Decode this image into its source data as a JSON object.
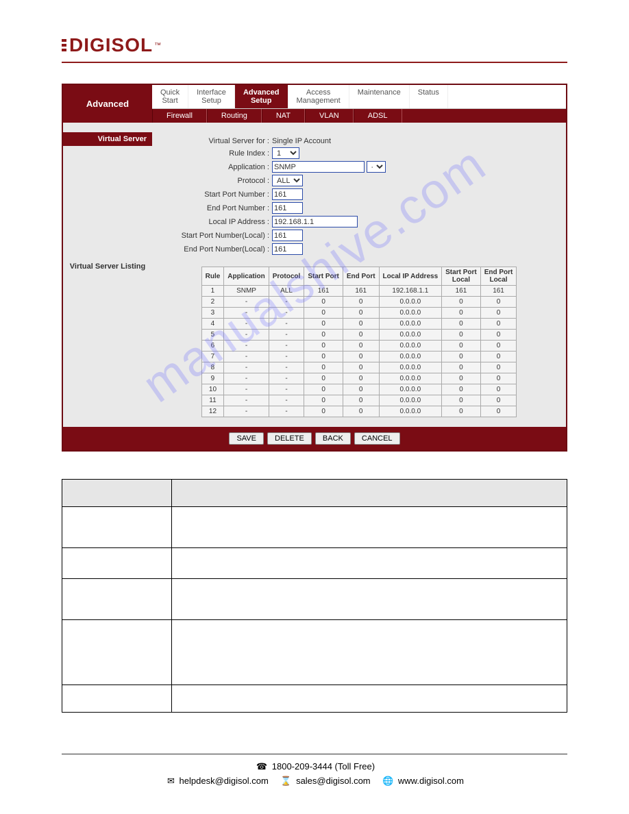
{
  "logo": {
    "text": "DIGISOL",
    "tm": "™"
  },
  "header": {
    "left_label": "Advanced",
    "tabs": [
      {
        "label": "Quick\nStart"
      },
      {
        "label": "Interface\nSetup"
      },
      {
        "label": "Advanced\nSetup",
        "active": true
      },
      {
        "label": "Access\nManagement"
      },
      {
        "label": "Maintenance"
      },
      {
        "label": "Status"
      }
    ],
    "subtabs": [
      "Firewall",
      "Routing",
      "NAT",
      "VLAN",
      "ADSL"
    ]
  },
  "sections": {
    "virtual_server": "Virtual Server",
    "virtual_server_listing": "Virtual Server Listing"
  },
  "form": {
    "virtual_server_for_label": "Virtual Server for :",
    "virtual_server_for_value": "Single IP Account",
    "rule_index_label": "Rule Index :",
    "rule_index_value": "1",
    "application_label": "Application :",
    "application_value": "SNMP",
    "application_select2": "-",
    "protocol_label": "Protocol :",
    "protocol_value": "ALL",
    "start_port_label": "Start Port Number :",
    "start_port_value": "161",
    "end_port_label": "End Port Number :",
    "end_port_value": "161",
    "local_ip_label": "Local IP Address :",
    "local_ip_value": "192.168.1.1",
    "start_port_local_label": "Start Port Number(Local) :",
    "start_port_local_value": "161",
    "end_port_local_label": "End Port Number(Local) :",
    "end_port_local_value": "161"
  },
  "listing_headers": [
    "Rule",
    "Application",
    "Protocol",
    "Start Port",
    "End Port",
    "Local IP Address",
    "Start Port Local",
    "End Port Local"
  ],
  "listing_rows": [
    [
      "1",
      "SNMP",
      "ALL",
      "161",
      "161",
      "192.168.1.1",
      "161",
      "161"
    ],
    [
      "2",
      "-",
      "-",
      "0",
      "0",
      "0.0.0.0",
      "0",
      "0"
    ],
    [
      "3",
      "-",
      "-",
      "0",
      "0",
      "0.0.0.0",
      "0",
      "0"
    ],
    [
      "4",
      "-",
      "-",
      "0",
      "0",
      "0.0.0.0",
      "0",
      "0"
    ],
    [
      "5",
      "-",
      "-",
      "0",
      "0",
      "0.0.0.0",
      "0",
      "0"
    ],
    [
      "6",
      "-",
      "-",
      "0",
      "0",
      "0.0.0.0",
      "0",
      "0"
    ],
    [
      "7",
      "-",
      "-",
      "0",
      "0",
      "0.0.0.0",
      "0",
      "0"
    ],
    [
      "8",
      "-",
      "-",
      "0",
      "0",
      "0.0.0.0",
      "0",
      "0"
    ],
    [
      "9",
      "-",
      "-",
      "0",
      "0",
      "0.0.0.0",
      "0",
      "0"
    ],
    [
      "10",
      "-",
      "-",
      "0",
      "0",
      "0.0.0.0",
      "0",
      "0"
    ],
    [
      "11",
      "-",
      "-",
      "0",
      "0",
      "0.0.0.0",
      "0",
      "0"
    ],
    [
      "12",
      "-",
      "-",
      "0",
      "0",
      "0.0.0.0",
      "0",
      "0"
    ]
  ],
  "buttons": {
    "save": "SAVE",
    "delete": "DELETE",
    "back": "BACK",
    "cancel": "CANCEL"
  },
  "watermark": "manualshive.com",
  "contact": {
    "phone": "1800-209-3444 (Toll Free)",
    "helpdesk": "helpdesk@digisol.com",
    "sales": "sales@digisol.com",
    "web": "www.digisol.com"
  }
}
